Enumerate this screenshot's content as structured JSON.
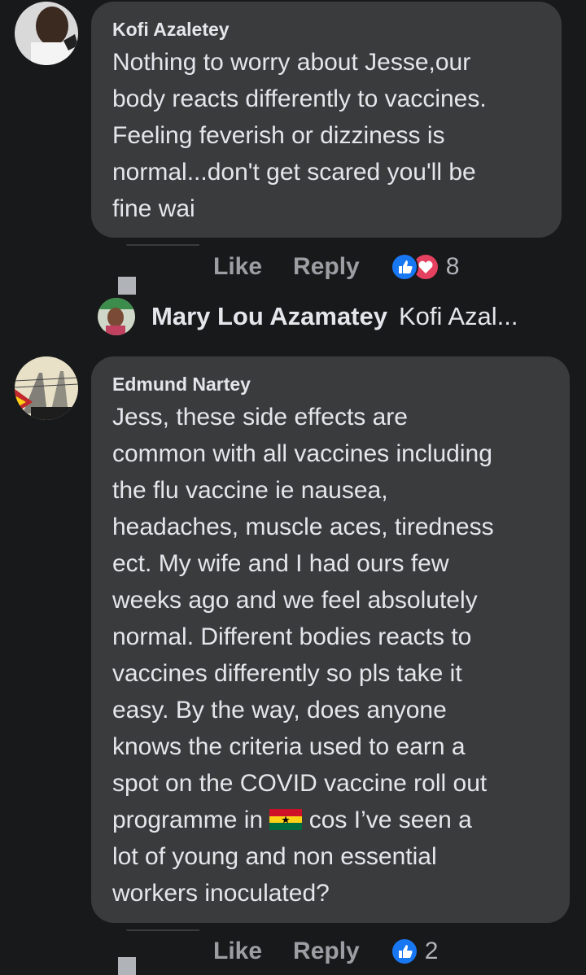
{
  "comments": [
    {
      "author": "Kofi Azaletey",
      "text": "Nothing to worry about Jesse,our\nbody reacts differently to vaccines.\nFeeling feverish or dizziness is\nnormal...don't get scared you'll be\nfine wai",
      "actions": {
        "like_label": "Like",
        "reply_label": "Reply"
      },
      "reactions": {
        "icons": [
          "like-icon",
          "love-icon"
        ],
        "count": "8"
      },
      "reply_preview": {
        "name": "Mary Lou Azamatey",
        "snippet": "Kofi Azal..."
      }
    },
    {
      "author": "Edmund Nartey",
      "text_before_flag": "Jess, these side effects are\ncommon with all vaccines including\nthe flu vaccine ie nausea,\nheadaches, muscle aces, tiredness\nect. My wife and I had ours few\nweeks ago and we feel absolutely\nnormal. Different bodies reacts to\nvaccines differently so pls take it\neasy. By the way, does anyone\nknows the criteria used to earn a\nspot on the COVID vaccine roll out\nprogramme in ",
      "flag": "ghana-flag-icon",
      "text_after_flag": " cos I’ve seen a\nlot of young and non essential\nworkers inoculated?",
      "actions": {
        "like_label": "Like",
        "reply_label": "Reply"
      },
      "reactions": {
        "icons": [
          "like-icon"
        ],
        "count": "2"
      }
    }
  ],
  "colors": {
    "background": "#18191a",
    "bubble": "#3a3b3c",
    "primary_text": "#e4e6eb",
    "secondary_text": "#9c9ea3",
    "like_blue": "#1877f2",
    "love_red": "#e4405f"
  }
}
